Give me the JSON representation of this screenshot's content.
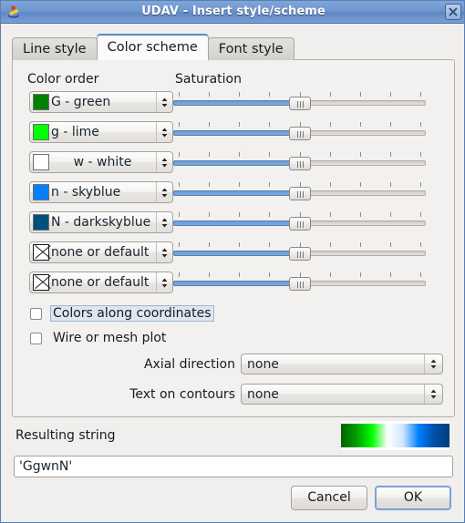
{
  "window": {
    "title": "UDAV - Insert style/scheme",
    "app_icon": "udav-icon",
    "close_icon": "close-icon"
  },
  "tabs": [
    {
      "label": "Line style",
      "active": false
    },
    {
      "label": "Color scheme",
      "active": true
    },
    {
      "label": "Font style",
      "active": false
    }
  ],
  "color_scheme": {
    "color_order_header": "Color order",
    "saturation_header": "Saturation",
    "rows": [
      {
        "label": "G - green",
        "swatch": "#008000",
        "kind": "color",
        "saturation": 50
      },
      {
        "label": "g - lime",
        "swatch": "#00ff00",
        "kind": "color",
        "saturation": 50
      },
      {
        "label": "w - white",
        "swatch": "#ffffff",
        "kind": "color",
        "saturation": 50
      },
      {
        "label": "n - skyblue",
        "swatch": "#0080ff",
        "kind": "color",
        "saturation": 50
      },
      {
        "label": "N - darkskyblue",
        "swatch": "#004f7c",
        "kind": "color",
        "saturation": 50
      },
      {
        "label": "none or default",
        "swatch": "",
        "kind": "none",
        "saturation": 50
      },
      {
        "label": "none or default",
        "swatch": "",
        "kind": "none",
        "saturation": 50
      }
    ],
    "checkboxes": [
      {
        "label": "Colors along coordinates",
        "checked": false,
        "focused": true
      },
      {
        "label": "Wire or mesh plot",
        "checked": false,
        "focused": false
      }
    ],
    "fields": [
      {
        "label": "Axial direction",
        "value": "none"
      },
      {
        "label": "Text on contours",
        "value": "none"
      }
    ]
  },
  "result": {
    "label": "Resulting string",
    "value": "'GgwnN'",
    "gradient_stops": [
      "#006400",
      "#00a000",
      "#00ff00",
      "#ffffff",
      "#cfe7ff",
      "#0080ff",
      "#0050a8",
      "#003f7d"
    ]
  },
  "buttons": {
    "cancel": "Cancel",
    "ok": "OK"
  }
}
